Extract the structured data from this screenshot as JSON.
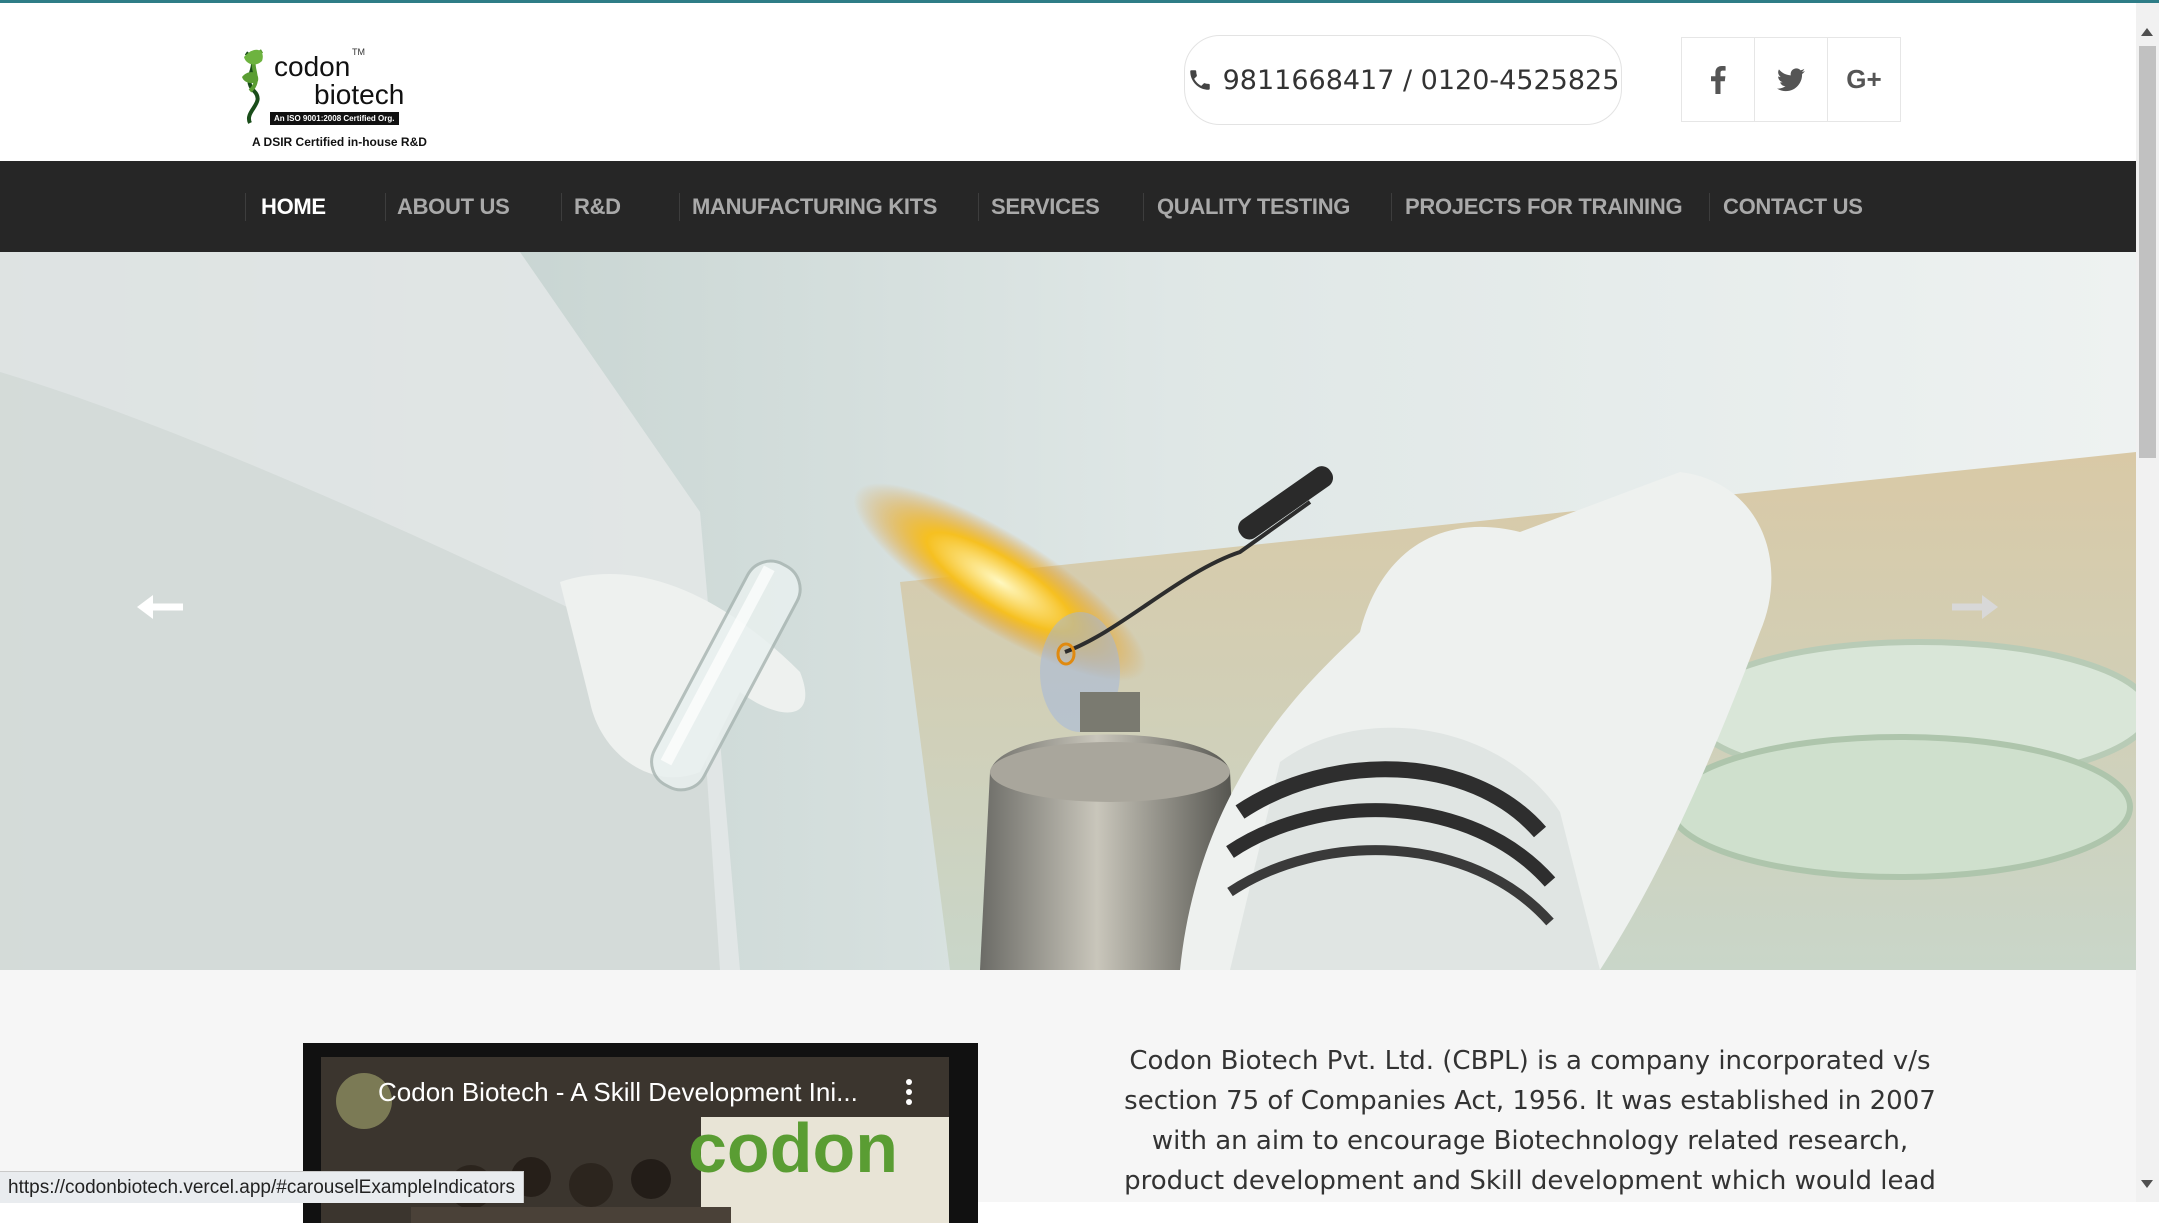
{
  "logo": {
    "line1": "codon",
    "trademark": "TM",
    "line2": "biotech",
    "iso": "An ISO 9001:2008 Certified Org.",
    "tagline": "A DSIR Certified in-house R&D"
  },
  "header": {
    "phone": "9811668417 / 0120-4525825",
    "phone_icon": "phone-icon",
    "social": [
      {
        "icon": "facebook-icon"
      },
      {
        "icon": "twitter-icon"
      },
      {
        "icon": "google-plus-icon",
        "label": "G+"
      }
    ]
  },
  "nav": {
    "items": [
      {
        "label": "HOME",
        "active": true
      },
      {
        "label": "ABOUT US"
      },
      {
        "label": "R&D"
      },
      {
        "label": "MANUFACTURING KITS"
      },
      {
        "label": "SERVICES"
      },
      {
        "label": "QUALITY TESTING"
      },
      {
        "label": "PROJECTS FOR TRAINING"
      },
      {
        "label": "CONTACT US"
      }
    ]
  },
  "carousel": {
    "prev_icon": "arrow-left-icon",
    "next_icon": "arrow-right-icon"
  },
  "video": {
    "title": "Codon Biotech - A Skill Development Ini...",
    "thumbnail_text": "codon"
  },
  "about": {
    "text": "Codon Biotech Pvt. Ltd. (CBPL) is a company incorporated v/s section 75 of Companies Act, 1956. It was established in 2007 with an aim to encourage Biotechnology related research, product development and Skill development which would lead"
  },
  "status_bar": {
    "url": "https://codonbiotech.vercel.app/#carouselExampleIndicators"
  },
  "colors": {
    "nav_bg": "#262626",
    "nav_text": "#a9a9a9",
    "nav_active": "#ffffff",
    "brand_green": "#5a9d33",
    "top_accent": "#2e7d87"
  }
}
